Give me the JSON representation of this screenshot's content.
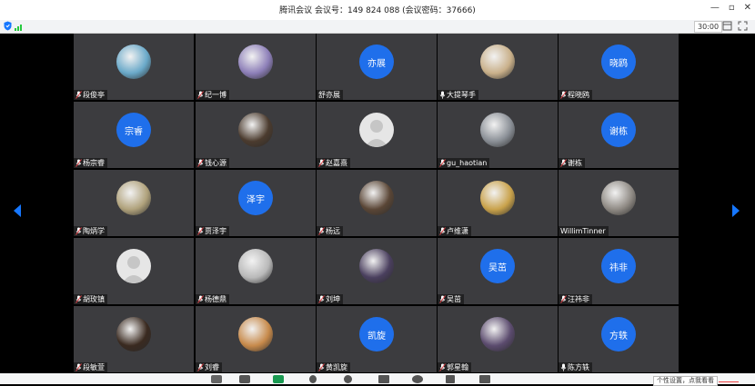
{
  "window": {
    "title": "腾讯会议 会议号：149 824 088  (会议密码：37666)",
    "controls": [
      "—",
      "▫",
      "✕"
    ]
  },
  "topbar": {
    "timer": "30:00"
  },
  "tiles": [
    {
      "name": "段俊亭",
      "mic": "muted",
      "avatar": {
        "type": "photo"
      }
    },
    {
      "name": "纪一博",
      "mic": "muted",
      "avatar": {
        "type": "photo"
      }
    },
    {
      "name": "舒亦展",
      "mic": "none",
      "avatar": {
        "type": "text",
        "text": "亦展"
      }
    },
    {
      "name": "大提琴手",
      "mic": "on",
      "avatar": {
        "type": "photo"
      }
    },
    {
      "name": "程晓鸥",
      "mic": "muted",
      "avatar": {
        "type": "text",
        "text": "晓鸥"
      }
    },
    {
      "name": "杨宗睿",
      "mic": "muted",
      "avatar": {
        "type": "text",
        "text": "宗睿"
      }
    },
    {
      "name": "钱心源",
      "mic": "muted",
      "avatar": {
        "type": "photo"
      }
    },
    {
      "name": "赵嘉熹",
      "mic": "muted",
      "avatar": {
        "type": "placeholder"
      }
    },
    {
      "name": "gu_haotian",
      "mic": "muted",
      "avatar": {
        "type": "photo"
      }
    },
    {
      "name": "谢栋",
      "mic": "muted",
      "avatar": {
        "type": "text",
        "text": "谢栋"
      }
    },
    {
      "name": "陶炳学",
      "mic": "muted",
      "avatar": {
        "type": "photo"
      }
    },
    {
      "name": "贾泽宇",
      "mic": "muted",
      "avatar": {
        "type": "text",
        "text": "泽宇"
      }
    },
    {
      "name": "杨远",
      "mic": "muted",
      "avatar": {
        "type": "photo"
      }
    },
    {
      "name": "卢维潇",
      "mic": "muted",
      "avatar": {
        "type": "photo"
      }
    },
    {
      "name": "WillimTinner",
      "mic": "none",
      "avatar": {
        "type": "photo"
      }
    },
    {
      "name": "胡玫镇",
      "mic": "muted",
      "avatar": {
        "type": "placeholder"
      }
    },
    {
      "name": "杨德鼎",
      "mic": "muted",
      "avatar": {
        "type": "photo"
      }
    },
    {
      "name": "刘坤",
      "mic": "muted",
      "avatar": {
        "type": "photo"
      }
    },
    {
      "name": "吴茁",
      "mic": "muted",
      "avatar": {
        "type": "text",
        "text": "吴茁"
      }
    },
    {
      "name": "汪祎非",
      "mic": "muted",
      "avatar": {
        "type": "text",
        "text": "祎非"
      }
    },
    {
      "name": "段敏萱",
      "mic": "muted",
      "avatar": {
        "type": "photo"
      }
    },
    {
      "name": "刘睿",
      "mic": "muted",
      "avatar": {
        "type": "photo"
      }
    },
    {
      "name": "黄凯旋",
      "mic": "muted",
      "avatar": {
        "type": "text",
        "text": "凯旋"
      }
    },
    {
      "name": "郭星翰",
      "mic": "muted",
      "avatar": {
        "type": "photo"
      }
    },
    {
      "name": "陈方轶",
      "mic": "on",
      "avatar": {
        "type": "text",
        "text": "方轶"
      }
    }
  ],
  "toast": {
    "text": "个性设置，点我看看"
  },
  "colors": {
    "avatar_blue": "#1f6feb",
    "tile_bg": "#3c3c3f",
    "accent": "#1677ff",
    "muted_red": "#e5484d",
    "signal_green": "#27c93f"
  },
  "icons": {
    "nav_left": "chevron-left-icon",
    "nav_right": "chevron-right-icon",
    "security": "shield-icon",
    "signal": "signal-icon"
  }
}
